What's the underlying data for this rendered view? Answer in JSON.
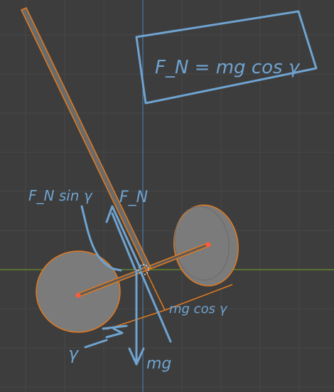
{
  "viewport": {
    "background_color": "#3d3d3d",
    "grid_color": "#474747",
    "x_axis_color": "#6a8f2a",
    "y_axis_color": "#4a7aa8",
    "selection_color": "#e07a1f",
    "annotation_color": "#6fa3d0"
  },
  "annotations": {
    "boxed_equation": "F_N = mg cos γ",
    "normal_force_label": "F_N",
    "friction_label": "F_N sin γ",
    "component_label": "mg cos γ",
    "weight_label": "mg",
    "angle_label": "γ"
  }
}
